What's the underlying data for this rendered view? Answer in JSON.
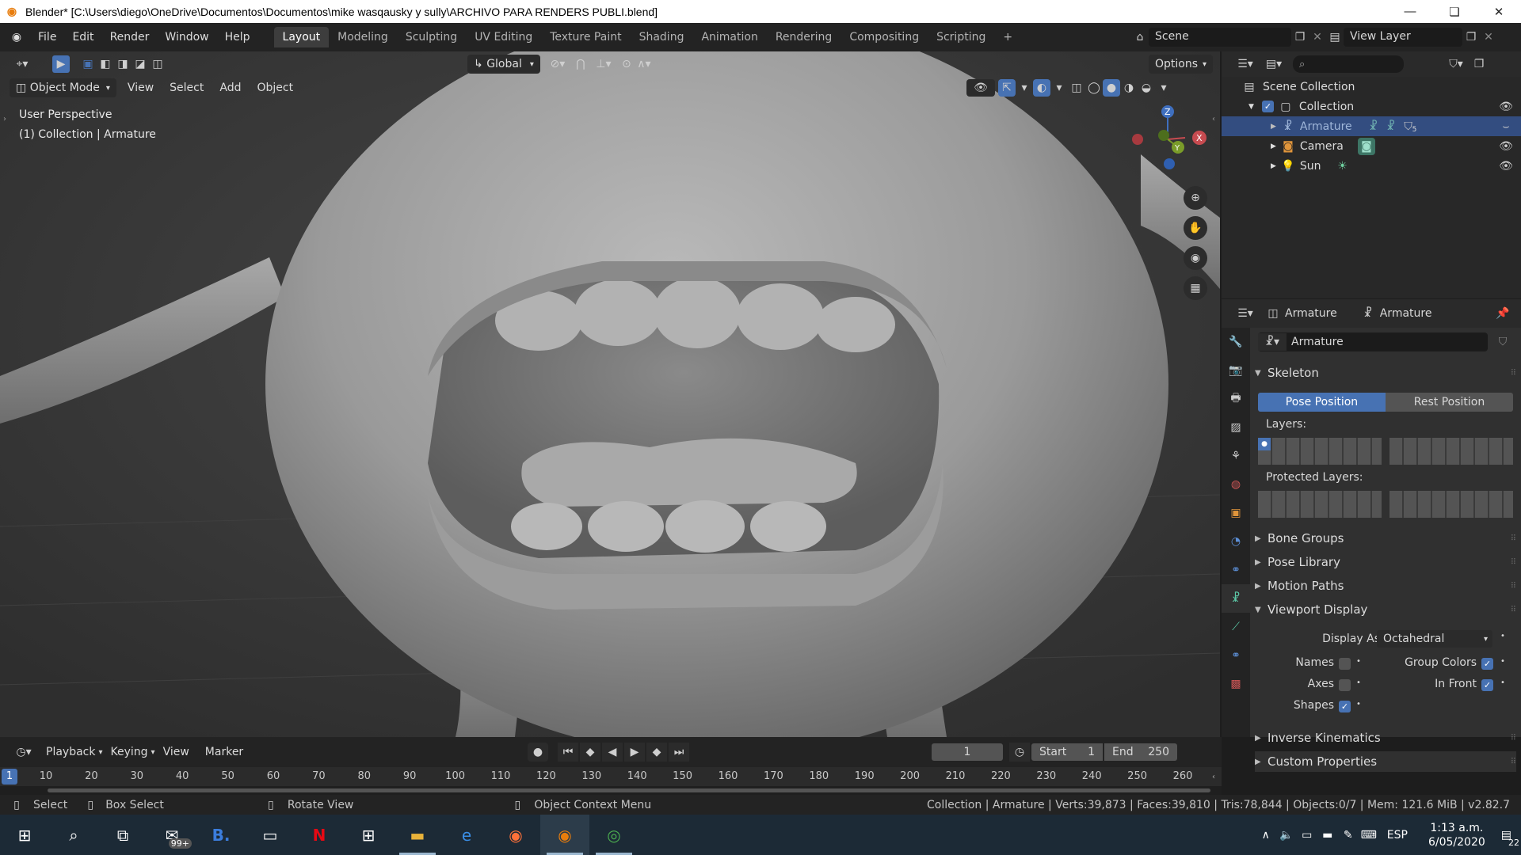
{
  "window": {
    "title": "Blender* [C:\\Users\\diego\\OneDrive\\Documentos\\Documentos\\mike wasqausky y sully\\ARCHIVO PARA RENDERS PUBLI.blend]"
  },
  "menu": [
    "File",
    "Edit",
    "Render",
    "Window",
    "Help"
  ],
  "workspaces": [
    "Layout",
    "Modeling",
    "Sculpting",
    "UV Editing",
    "Texture Paint",
    "Shading",
    "Animation",
    "Rendering",
    "Compositing",
    "Scripting"
  ],
  "scene": {
    "name": "Scene",
    "view_layer": "View Layer"
  },
  "viewport": {
    "transform_orientation": "Global",
    "options_label": "Options",
    "mode": "Object Mode",
    "menus": [
      "View",
      "Select",
      "Add",
      "Object"
    ],
    "overlay_line1": "User Perspective",
    "overlay_line2": "(1) Collection | Armature",
    "gizmo": {
      "z": "Z",
      "y": "Y",
      "x": "X"
    }
  },
  "outliner": {
    "search_placeholder": "",
    "root": "Scene Collection",
    "collection": "Collection",
    "items": [
      {
        "name": "Armature",
        "badge": "5"
      },
      {
        "name": "Camera"
      },
      {
        "name": "Sun"
      }
    ]
  },
  "properties": {
    "breadcrumb_object": "Armature",
    "breadcrumb_data": "Armature",
    "datablock_name": "Armature",
    "skeleton": "Skeleton",
    "pose_position": "Pose Position",
    "rest_position": "Rest Position",
    "layers_label": "Layers:",
    "protected_layers_label": "Protected Layers:",
    "bone_groups": "Bone Groups",
    "pose_library": "Pose Library",
    "motion_paths": "Motion Paths",
    "viewport_display": "Viewport Display",
    "display_as_label": "Display As",
    "display_as_value": "Octahedral",
    "names": "Names",
    "axes": "Axes",
    "shapes": "Shapes",
    "group_colors": "Group Colors",
    "in_front": "In Front",
    "inverse_kinematics": "Inverse Kinematics",
    "custom_properties": "Custom Properties"
  },
  "timeline": {
    "menus": [
      "Playback",
      "Keying",
      "View",
      "Marker"
    ],
    "current_frame": "1",
    "start_label": "Start",
    "start_value": "1",
    "end_label": "End",
    "end_value": "250",
    "ruler": [
      "10",
      "20",
      "30",
      "40",
      "50",
      "60",
      "70",
      "80",
      "90",
      "100",
      "110",
      "120",
      "130",
      "140",
      "150",
      "160",
      "170",
      "180",
      "190",
      "200",
      "210",
      "220",
      "230",
      "240",
      "250",
      "260"
    ],
    "playhead": "1"
  },
  "status": {
    "select": "Select",
    "box_select": "Box Select",
    "rotate_view": "Rotate View",
    "context_menu": "Object Context Menu",
    "stats": "Collection | Armature | Verts:39,873 | Faces:39,810 | Tris:78,844 | Objects:0/7 | Mem: 121.6 MiB | v2.82.7"
  },
  "taskbar": {
    "mail_badge": "99+",
    "lang": "ESP",
    "time": "1:13 a.m.",
    "date": "6/05/2020",
    "notifications": "22"
  }
}
